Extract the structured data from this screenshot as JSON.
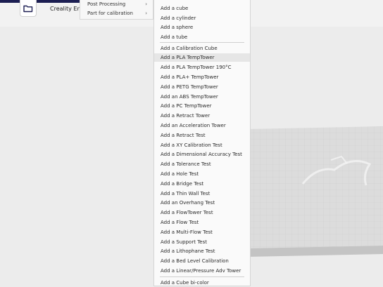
{
  "header": {
    "folder_icon": "folder-icon",
    "title": "Creality End"
  },
  "menu_main": {
    "items": [
      {
        "label": "Post Processing",
        "arrow": "›"
      },
      {
        "label": "Part for calibration",
        "arrow": "›"
      }
    ]
  },
  "submenu_calibration": {
    "group_basic": [
      "Add a cube",
      "Add a cylinder",
      "Add a sphere",
      "Add a tube"
    ],
    "group_calibration": [
      "Add a Calibration Cube",
      "Add a PLA TempTower",
      "Add a PLA TempTower 190°C",
      "Add a PLA+ TempTower",
      "Add a PETG TempTower",
      "Add an ABS TempTower",
      "Add a PC TempTower",
      "Add a Retract Tower",
      "Add an Acceleration Tower",
      "Add a Retract Test",
      "Add a XY Calibration Test",
      "Add a Dimensional Accuracy Test",
      "Add a Tolerance Test",
      "Add a Hole Test",
      "Add a Bridge Test",
      "Add a Thin Wall Test",
      "Add an Overhang Test",
      "Add a FlowTower Test",
      "Add a Flow Test",
      "Add a Multi-Flow Test",
      "Add a Support Test",
      "Add a Lithophane Test",
      "Add a Bed Level Calibration",
      "Add a Linear/Pressure Adv Tower"
    ],
    "group_extra": [
      "Add a Cube bi-color"
    ],
    "highlighted_item": "Add a PLA TempTower"
  },
  "colors": {
    "accent_strip": "#1c1e52",
    "menu_background": "#fafafa",
    "highlight": "#e6e6e6"
  }
}
